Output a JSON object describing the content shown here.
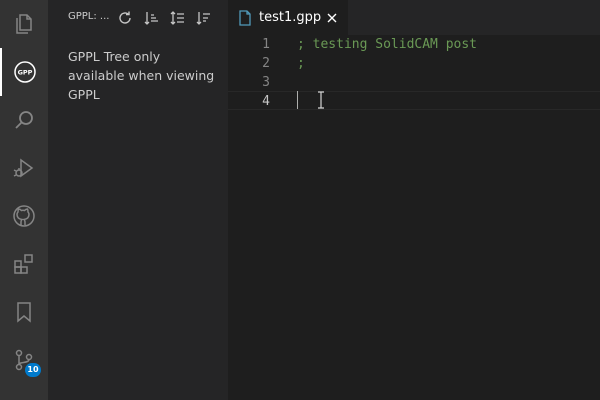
{
  "activity_bar": {
    "items": [
      {
        "icon": "files-icon"
      },
      {
        "icon": "gppl-icon",
        "glyph": "GPP",
        "active": true
      },
      {
        "icon": "search-icon"
      },
      {
        "icon": "run-debug-icon"
      },
      {
        "icon": "github-icon"
      },
      {
        "icon": "extensions-icon"
      },
      {
        "icon": "bookmark-icon"
      },
      {
        "icon": "source-control-icon",
        "badge": "10"
      }
    ]
  },
  "sidebar": {
    "title": "GPPL: ...",
    "actions": [
      "refresh-icon",
      "sort-ascending-icon",
      "sort-alpha-icon",
      "sort-descending-icon"
    ],
    "message": "GPPL Tree only available when viewing GPPL"
  },
  "editor": {
    "tab": {
      "label": "test1.gpp",
      "icon": "file-icon"
    },
    "lines": [
      {
        "number": "1",
        "text": "; testing SolidCAM post"
      },
      {
        "number": "2",
        "text": ";"
      },
      {
        "number": "3",
        "text": ""
      },
      {
        "number": "4",
        "text": ""
      }
    ],
    "current_line": "4"
  },
  "colors": {
    "activity_bar": "#333333",
    "sidebar": "#252526",
    "editor": "#1e1e1e",
    "comment": "#6a9955",
    "badge": "#007acc",
    "tab_icon": "#519aba"
  }
}
